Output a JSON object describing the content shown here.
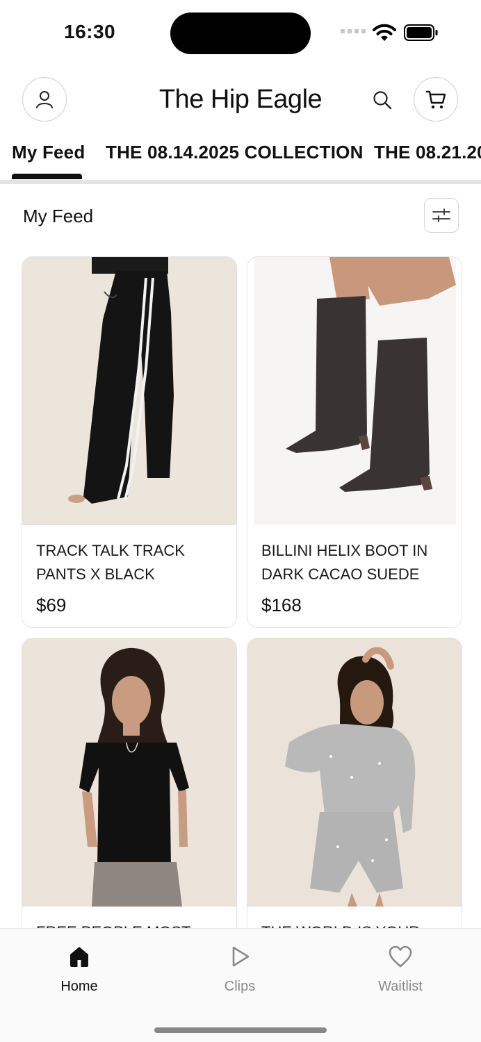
{
  "status_bar": {
    "time": "16:30"
  },
  "header": {
    "title": "The Hip Eagle",
    "icons": {
      "account": "user-icon",
      "search": "search-icon",
      "cart": "cart-icon"
    }
  },
  "tabs": [
    {
      "label": "My Feed",
      "active": true
    },
    {
      "label": "THE 08.14.2025 COLLECTION",
      "active": false
    },
    {
      "label": "THE 08.21.20",
      "active": false
    }
  ],
  "feed": {
    "title": "My Feed",
    "filter_icon": "sliders-icon"
  },
  "products": [
    {
      "name": "TRACK TALK TRACK PANTS X BLACK",
      "price": "$69"
    },
    {
      "name": "BILLINI HELIX BOOT IN DARK CACAO SUEDE",
      "price": "$168"
    },
    {
      "name": "FREE PEOPLE MOST",
      "price": ""
    },
    {
      "name": "THE WORLD IS YOUR",
      "price": ""
    }
  ],
  "bottom_nav": [
    {
      "label": "Home",
      "icon": "home-icon",
      "active": true
    },
    {
      "label": "Clips",
      "icon": "play-icon",
      "active": false
    },
    {
      "label": "Waitlist",
      "icon": "heart-icon",
      "active": false
    }
  ],
  "colors": {
    "text": "#111111",
    "inactive_nav": "#8a8a8a",
    "divider": "#e2e4e6",
    "card_border": "#e3e3e3"
  }
}
